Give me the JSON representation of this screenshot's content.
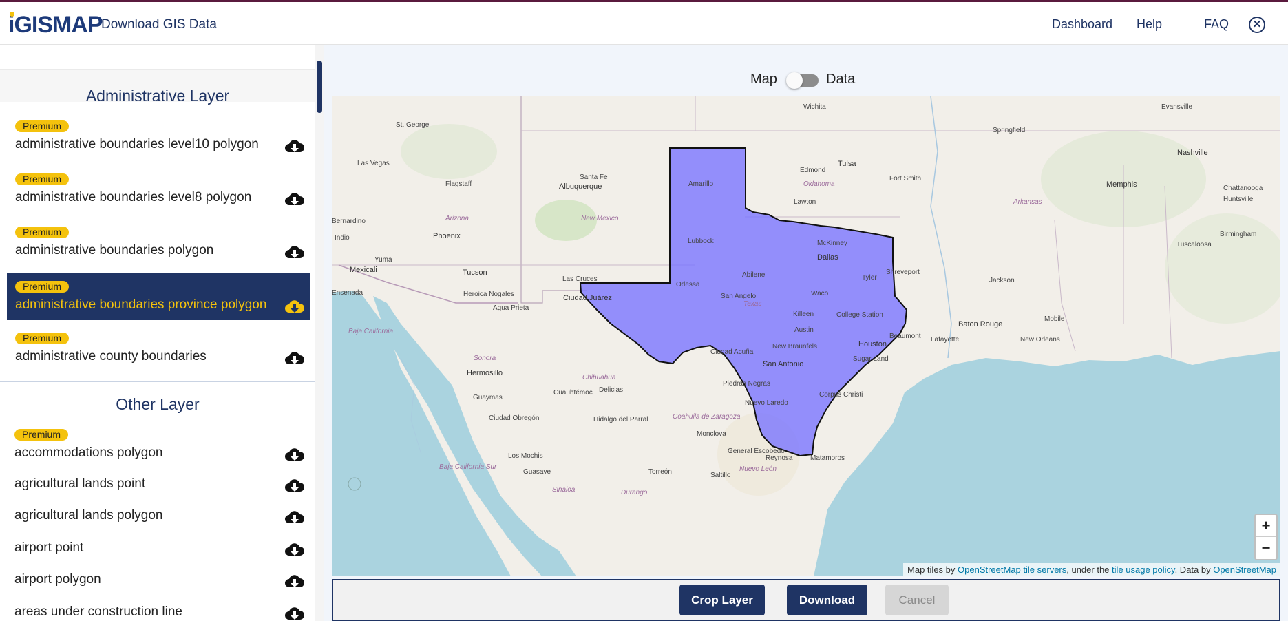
{
  "header": {
    "logo_text": "GISMAP",
    "logo_i": "i",
    "app_title": "Download GIS Data",
    "nav": [
      "Dashboard",
      "Help",
      "FAQ"
    ],
    "close_icon": "close-circle-icon"
  },
  "sidebar": {
    "admin_title": "Administrative Layer",
    "admin_items": [
      {
        "badge": "Premium",
        "label": "administrative boundaries level10 polygon",
        "active": false
      },
      {
        "badge": "Premium",
        "label": "administrative boundaries level8 polygon",
        "active": false
      },
      {
        "badge": "Premium",
        "label": "administrative boundaries polygon",
        "active": false
      },
      {
        "badge": "Premium",
        "label": "administrative boundaries province polygon",
        "active": true
      },
      {
        "badge": "Premium",
        "label": "administrative county boundaries",
        "active": false
      }
    ],
    "other_title": "Other Layer",
    "other_items": [
      {
        "badge": "Premium",
        "label": "accommodations polygon"
      },
      {
        "badge": "",
        "label": "agricultural lands point"
      },
      {
        "badge": "",
        "label": "agricultural lands polygon"
      },
      {
        "badge": "",
        "label": "airport point"
      },
      {
        "badge": "",
        "label": "airport polygon"
      },
      {
        "badge": "",
        "label": "areas under construction line"
      }
    ],
    "download_icon": "cloud-download-icon"
  },
  "main": {
    "toggle": {
      "left_label": "Map",
      "right_label": "Data",
      "state": "Map"
    },
    "map": {
      "highlight_color": "#7b76ff",
      "labels": {
        "cities": [
          "Wichita",
          "Evansville",
          "St. George",
          "Springfield",
          "Nashville",
          "Las Vegas",
          "Tulsa",
          "Edmond",
          "Flagstaff",
          "Albuquerque",
          "Santa Fe",
          "Amarillo",
          "Fort Smith",
          "Memphis",
          "Chattanooga",
          "Lawton",
          "Huntsville",
          "Birmingham",
          "Phoenix",
          "Lubbock",
          "McKinney",
          "Dallas",
          "Tuscaloosa",
          "Yuma",
          "Mexicali",
          "Tucson",
          "Las Cruces",
          "Odessa",
          "Abilene",
          "Tyler",
          "Shreveport",
          "Jackson",
          "Heroica Nogales",
          "Ciudad Juárez",
          "Agua Prieta",
          "San Angelo",
          "Waco",
          "Killeen",
          "College Station",
          "Baton Rouge",
          "Mobile",
          "Austin",
          "Lafayette",
          "New Orleans",
          "Houston",
          "Beaumont",
          "New Braunfels",
          "San Antonio",
          "Sugar Land",
          "Ciudad Acuña",
          "Hermosillo",
          "Delicias",
          "Piedras Negras",
          "Corpus Christi",
          "Guaymas",
          "Cuauhtémoc",
          "Nuevo Laredo",
          "Ciudad Obregón",
          "Hidalgo del Parral",
          "Monclova",
          "General Escobedo",
          "Reynosa",
          "Matamoros",
          "Los Mochis",
          "Guasave",
          "Torreón",
          "Saltillo",
          "Indio",
          "Bernardino",
          "Ensenada"
        ],
        "states": [
          "Oklahoma",
          "Arkansas",
          "Arizona",
          "New Mexico",
          "Texas",
          "Baja California",
          "Sonora",
          "Chihuahua",
          "Coahuila de Zaragoza",
          "Baja California Sur",
          "Nuevo León",
          "Sinaloa",
          "Durango"
        ]
      },
      "zoom_in": "+",
      "zoom_out": "−",
      "attribution": {
        "p1": "Map tiles by ",
        "l1": "OpenStreetMap tile servers",
        "p2": ", under the ",
        "l2": "tile usage policy",
        "p3": ". Data by ",
        "l3": "OpenStreetMap"
      }
    },
    "actions": {
      "crop": "Crop Layer",
      "download": "Download",
      "cancel": "Cancel"
    }
  }
}
